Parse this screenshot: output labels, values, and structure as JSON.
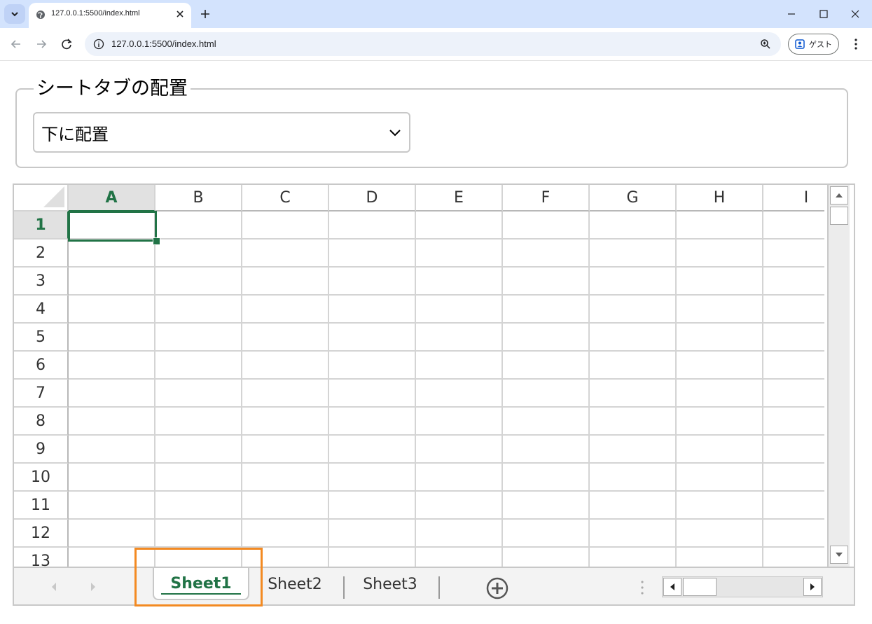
{
  "browser": {
    "tab_title": "127.0.0.1:5500/index.html",
    "url": "127.0.0.1:5500/index.html",
    "profile_label": "ゲスト"
  },
  "page": {
    "legend": "シートタブの配置",
    "select_value": "下に配置"
  },
  "spreadsheet": {
    "columns": [
      "A",
      "B",
      "C",
      "D",
      "E",
      "F",
      "G",
      "H",
      "I"
    ],
    "rows": [
      "1",
      "2",
      "3",
      "4",
      "5",
      "6",
      "7",
      "8",
      "9",
      "10",
      "11",
      "12",
      "13"
    ],
    "active_cell": "A1",
    "sheet_tabs": [
      "Sheet1",
      "Sheet2",
      "Sheet3"
    ],
    "active_sheet": "Sheet1"
  },
  "colors": {
    "accent": "#217346",
    "highlight": "#f38a22",
    "tabstrip": "#d3e3fd"
  }
}
